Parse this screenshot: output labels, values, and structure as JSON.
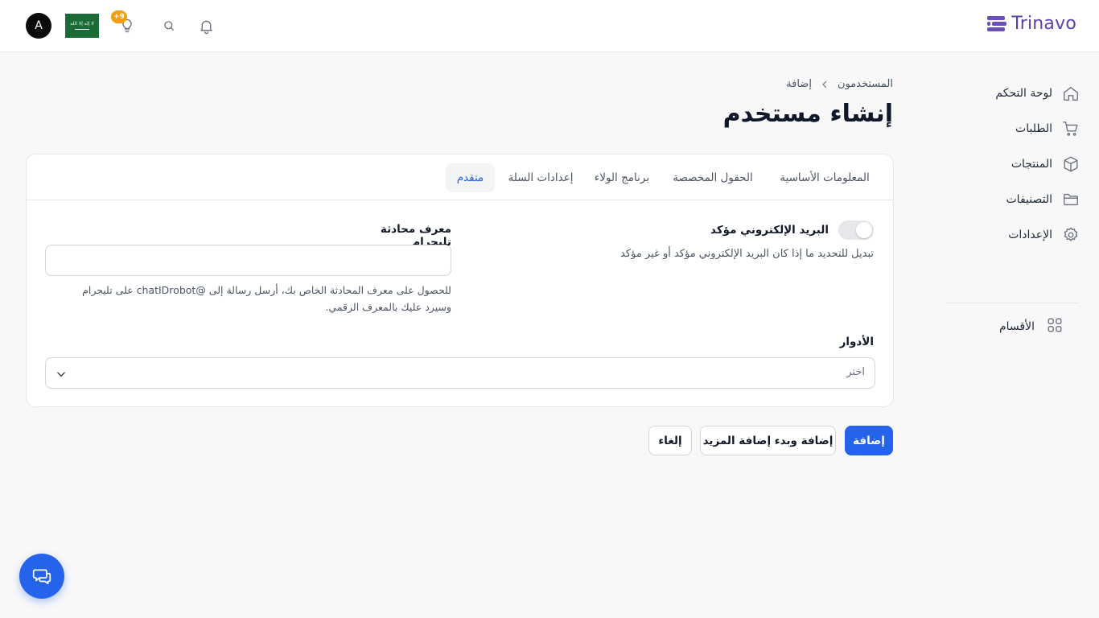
{
  "app": {
    "brand": "Trinavo"
  },
  "topbar": {
    "avatar_initial": "A",
    "ideas_badge": "+9"
  },
  "sidebar": {
    "items": [
      {
        "label": "لوحة التحكم",
        "icon": "home-icon"
      },
      {
        "label": "الطلبات",
        "icon": "cart-icon"
      },
      {
        "label": "المنتجات",
        "icon": "box-icon"
      },
      {
        "label": "التصنيفات",
        "icon": "folder-icon"
      },
      {
        "label": "الإعدادات",
        "icon": "gear-icon"
      }
    ],
    "sections_label": "الأقسام"
  },
  "breadcrumb": {
    "parent": "المستخدمون",
    "current": "إضافة"
  },
  "page": {
    "title": "إنشاء مستخدم"
  },
  "tabs": [
    {
      "label": "المعلومات الأساسية",
      "active": false
    },
    {
      "label": "الحقول المخصصة",
      "active": false
    },
    {
      "label": "برنامج الولاء",
      "active": false
    },
    {
      "label": "إعدادات السلة",
      "active": false
    },
    {
      "label": "متقدم",
      "active": true
    }
  ],
  "form": {
    "email_verified": {
      "label": "البريد الإلكتروني مؤكد",
      "help": "تبديل للتحديد ما إذا كان البريد الإلكتروني مؤكد أو غير مؤكد",
      "value": false
    },
    "telegram": {
      "label": "معرف محادثة تليجرام",
      "value": "",
      "help_line1": "للحصول على معرف المحادثة الخاص بك، أرسل رسالة إلى @chatIDrobot على تليجرام",
      "help_line2": "وسيرد عليك بالمعرف الرقمي."
    },
    "roles": {
      "label": "الأدوار",
      "placeholder": "اختر"
    }
  },
  "actions": {
    "add": "إضافة",
    "add_and_more": "إضافة وبدء إضافة المزيد",
    "cancel": "إلغاء"
  },
  "colors": {
    "primary": "#2563eb",
    "brand": "#5b3fa8",
    "badge": "#f59e0b"
  }
}
